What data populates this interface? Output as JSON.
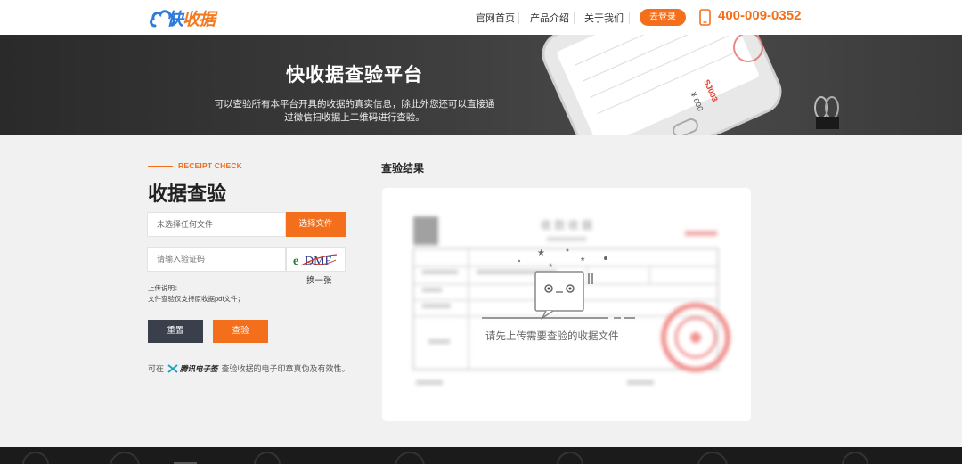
{
  "header": {
    "logo_text_main": "快",
    "logo_text_accent": "收据",
    "nav": [
      {
        "label": "官网首页"
      },
      {
        "label": "产品介绍"
      },
      {
        "label": "关于我们"
      }
    ],
    "login_label": "去登录",
    "phone": "400-009-0352"
  },
  "banner": {
    "title": "快收据查验平台",
    "description": "可以查验所有本平台开具的收据的真实信息，除此外您还可以直接通过微信扫收据上二维码进行查验。",
    "phone_receipt_code": "SJ003",
    "phone_receipt_amount": "¥ 600"
  },
  "form": {
    "tag": "RECEIPT CHECK",
    "title": "收据查验",
    "file_placeholder": "未选择任何文件",
    "file_button": "选择文件",
    "code_placeholder": "请输入验证码",
    "captcha_text": "eDMF",
    "captcha_swap": "换一张",
    "upload_note_title": "上传说明：",
    "upload_note_body": "文件查验仅支持原收据pdf文件；",
    "reset_label": "重置",
    "check_label": "查验",
    "esign_prefix": "可在",
    "esign_brand": "腾讯电子签",
    "esign_suffix": "查验收据的电子印章真伪及有效性。"
  },
  "result": {
    "title": "查验结果",
    "empty_text": "请先上传需要查验的收据文件",
    "receipt_preview_title": "收 款 收 据"
  },
  "colors": {
    "accent": "#f36f1b",
    "brand_blue": "#2f7bd8",
    "dark_button": "#3a3f4c"
  }
}
